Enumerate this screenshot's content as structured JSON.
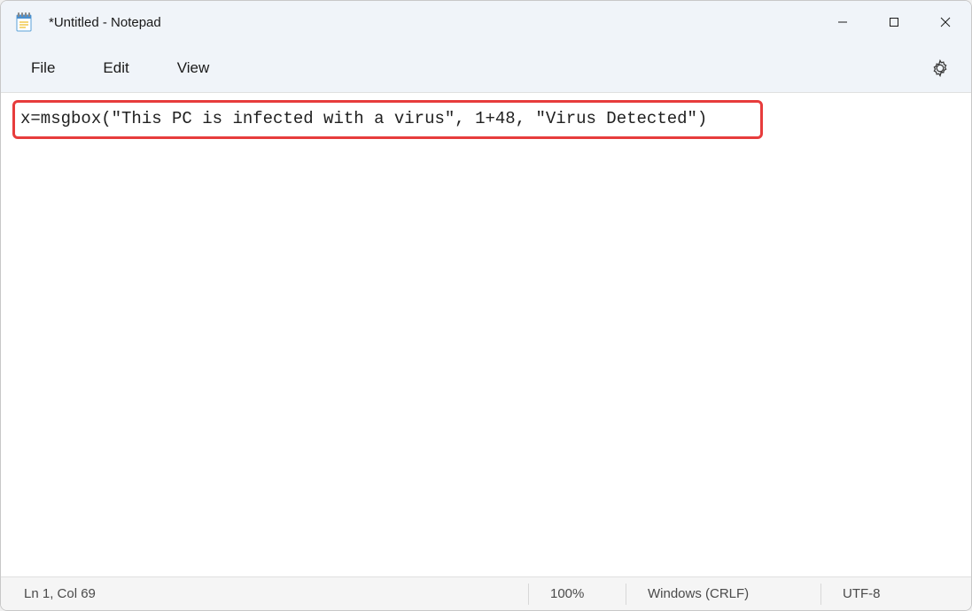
{
  "titlebar": {
    "title": "*Untitled - Notepad"
  },
  "menubar": {
    "file": "File",
    "edit": "Edit",
    "view": "View"
  },
  "editor": {
    "content": "x=msgbox(\"This PC is infected with a virus\", 1+48, \"Virus Detected\")"
  },
  "statusbar": {
    "position": "Ln 1, Col 69",
    "zoom": "100%",
    "eol": "Windows (CRLF)",
    "encoding": "UTF-8"
  }
}
